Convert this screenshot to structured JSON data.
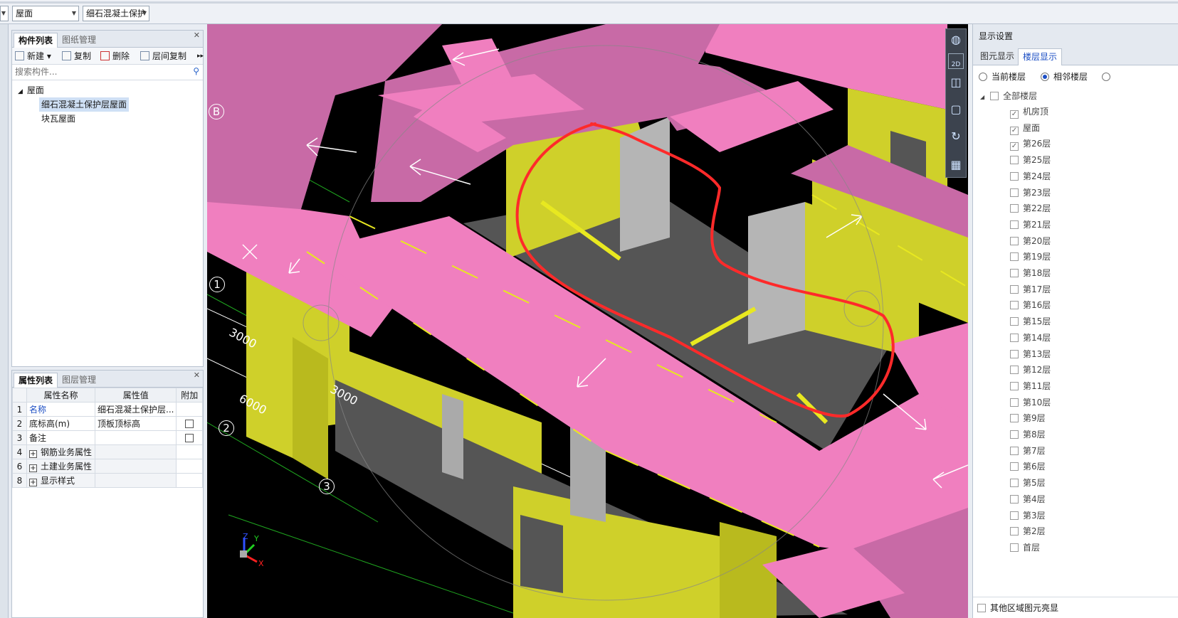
{
  "toolbar": {
    "floor_select": "屋面",
    "component_select": "细石混凝土保护"
  },
  "component_panel": {
    "tabs": [
      "构件列表",
      "图纸管理"
    ],
    "buttons": {
      "new": "新建",
      "copy": "复制",
      "delete": "删除",
      "floor_copy": "层间复制"
    },
    "search_placeholder": "搜索构件...",
    "tree": {
      "root": "屋面",
      "children": [
        "细石混凝土保护层屋面",
        "块瓦屋面"
      ]
    }
  },
  "property_panel": {
    "tabs": [
      "属性列表",
      "图层管理"
    ],
    "columns": [
      "属性名称",
      "属性值",
      "附加"
    ],
    "rows": [
      {
        "num": "1",
        "name": "名称",
        "value": "细石混凝土保护层..."
      },
      {
        "num": "2",
        "name": "底标高(m)",
        "value": "顶板顶标高"
      },
      {
        "num": "3",
        "name": "备注",
        "value": ""
      },
      {
        "num": "4",
        "name": "钢筋业务属性",
        "value": ""
      },
      {
        "num": "6",
        "name": "土建业务属性",
        "value": ""
      },
      {
        "num": "8",
        "name": "显示样式",
        "value": ""
      }
    ]
  },
  "viewport": {
    "labels": {
      "axis_b": "B",
      "axis_1": "1",
      "axis_2": "2",
      "axis_3": "3",
      "dim1": "3000",
      "dim2": "6000",
      "dim3": "3000"
    },
    "gizmo": {
      "z": "Z",
      "y": "Y",
      "x": "X"
    },
    "view_2d": "2D"
  },
  "display_panel": {
    "title": "显示设置",
    "tabs": [
      "图元显示",
      "楼层显示"
    ],
    "radios": [
      "当前楼层",
      "相邻楼层"
    ],
    "all_floors": "全部楼层",
    "floors": [
      "机房顶",
      "屋面",
      "第26层",
      "第25层",
      "第24层",
      "第23层",
      "第22层",
      "第21层",
      "第20层",
      "第19层",
      "第18层",
      "第17层",
      "第16层",
      "第15层",
      "第14层",
      "第13层",
      "第12层",
      "第11层",
      "第10层",
      "第9层",
      "第8层",
      "第7层",
      "第6层",
      "第5层",
      "第4层",
      "第3层",
      "第2层",
      "首层"
    ],
    "footer": "其他区域图元亮显"
  },
  "colors": {
    "roof_pink": "#f07fbf",
    "wall_yellow": "#cfd02a",
    "slab_grey": "#555555",
    "markup_red": "#ff2a2a"
  }
}
